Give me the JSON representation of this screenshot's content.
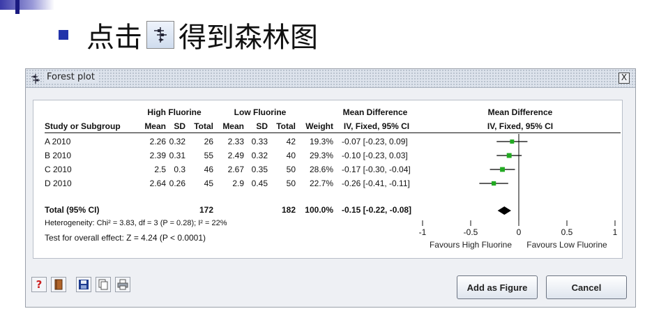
{
  "slide": {
    "heading": "点击",
    "heading_suffix": "得到森林图"
  },
  "dialog": {
    "title": "Forest plot",
    "close": "X",
    "headers": {
      "group1": "High Fluorine",
      "group2": "Low Fluorine",
      "md_numeric": "Mean Difference",
      "md_graph": "Mean Difference",
      "study": "Study or Subgroup",
      "mean1": "Mean",
      "sd1": "SD",
      "total1": "Total",
      "mean2": "Mean",
      "sd2": "SD",
      "total2": "Total",
      "weight": "Weight",
      "method": "IV, Fixed, 95% CI",
      "method_graph": "IV, Fixed, 95% CI"
    },
    "studies": [
      {
        "name": "A 2010",
        "mean1": "2.26",
        "sd1": "0.32",
        "total1": "26",
        "mean2": "2.33",
        "sd2": "0.33",
        "total2": "42",
        "weight": "19.3%",
        "ci": "-0.07 [-0.23, 0.09]"
      },
      {
        "name": "B 2010",
        "mean1": "2.39",
        "sd1": "0.31",
        "total1": "55",
        "mean2": "2.49",
        "sd2": "0.32",
        "total2": "40",
        "weight": "29.3%",
        "ci": "-0.10 [-0.23, 0.03]"
      },
      {
        "name": "C 2010",
        "mean1": "2.5",
        "sd1": "0.3",
        "total1": "46",
        "mean2": "2.67",
        "sd2": "0.35",
        "total2": "50",
        "weight": "28.6%",
        "ci": "-0.17 [-0.30, -0.04]"
      },
      {
        "name": "D 2010",
        "mean1": "2.64",
        "sd1": "0.26",
        "total1": "45",
        "mean2": "2.9",
        "sd2": "0.45",
        "total2": "50",
        "weight": "22.7%",
        "ci": "-0.26 [-0.41, -0.11]"
      }
    ],
    "total": {
      "label": "Total (95% CI)",
      "total1": "172",
      "total2": "182",
      "weight": "100.0%",
      "ci": "-0.15 [-0.22, -0.08]"
    },
    "heterogeneity": "Heterogeneity: Chi² = 3.83, df = 3 (P = 0.28); I² = 22%",
    "overall_effect": "Test for overall effect: Z = 4.24 (P < 0.0001)",
    "axis": {
      "ticks": [
        "-1",
        "-0.5",
        "0",
        "0.5",
        "1"
      ],
      "favours_left": "Favours High Fluorine",
      "favours_right": "Favours Low Fluorine"
    },
    "buttons": {
      "add_as_figure": "Add as Figure",
      "cancel": "Cancel"
    }
  },
  "plot_data": {
    "xlim": [
      -1,
      1
    ],
    "studies": [
      {
        "md": -0.07,
        "lo": -0.23,
        "hi": 0.09,
        "weight": 19.3
      },
      {
        "md": -0.1,
        "lo": -0.23,
        "hi": 0.03,
        "weight": 29.3
      },
      {
        "md": -0.17,
        "lo": -0.3,
        "hi": -0.04,
        "weight": 28.6
      },
      {
        "md": -0.26,
        "lo": -0.41,
        "hi": -0.11,
        "weight": 22.7
      }
    ],
    "pooled": {
      "md": -0.15,
      "lo": -0.22,
      "hi": -0.08
    },
    "colors": {
      "marker": "#22aa22",
      "line": "#000000",
      "diamond": "#000000"
    }
  }
}
